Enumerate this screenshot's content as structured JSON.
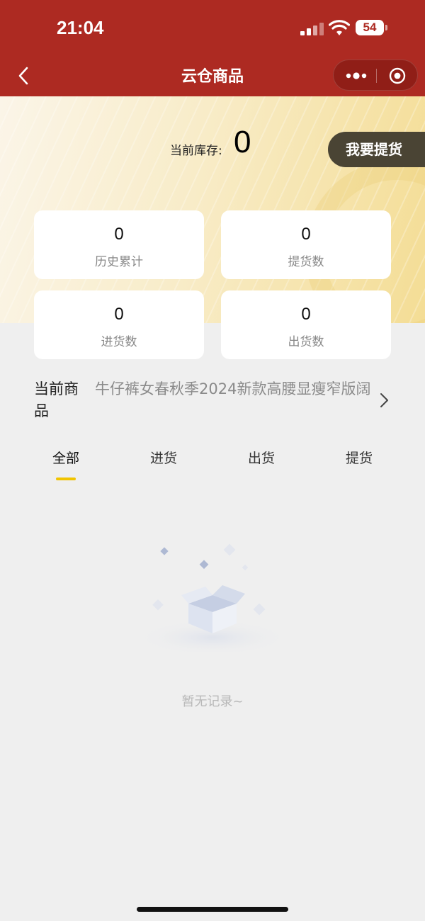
{
  "status_bar": {
    "time": "21:04",
    "battery": "54",
    "icons": [
      "signal-icon",
      "wifi-icon",
      "battery-icon"
    ]
  },
  "nav": {
    "title": "云仓商品",
    "back_icon": "chevron-left-icon",
    "capsule_icons": [
      "more-dots-icon",
      "close-target-icon"
    ]
  },
  "colors": {
    "nav_bg": "#ad2a22",
    "banner_gold": "#f4dd95",
    "pickup_button_bg": "#4a4434",
    "tab_indicator": "#f1c400"
  },
  "stock": {
    "label": "当前库存:",
    "value": "0",
    "pickup_button": "我要提货"
  },
  "stats": [
    {
      "value": "0",
      "label": "历史累计"
    },
    {
      "value": "0",
      "label": "提货数"
    },
    {
      "value": "0",
      "label": "进货数"
    },
    {
      "value": "0",
      "label": "出货数"
    }
  ],
  "current_product": {
    "label": "当前商品",
    "name": "牛仔裤女春秋季2024新款高腰显瘦窄版阔"
  },
  "tabs": [
    {
      "label": "全部",
      "active": true
    },
    {
      "label": "进货",
      "active": false
    },
    {
      "label": "出货",
      "active": false
    },
    {
      "label": "提货",
      "active": false
    }
  ],
  "empty_state": {
    "text": "暂无记录~",
    "icon": "empty-box-icon"
  }
}
